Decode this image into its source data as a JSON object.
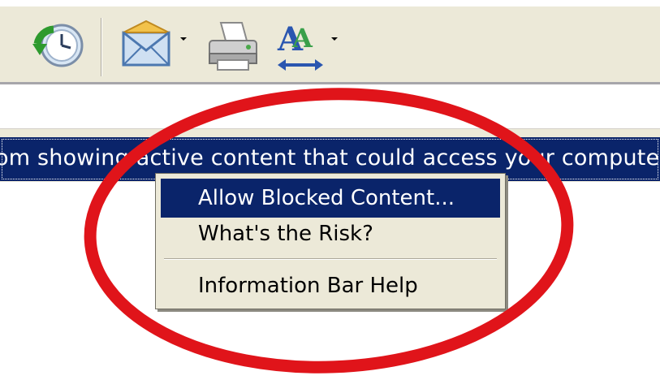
{
  "toolbar": {
    "buttons": [
      {
        "name": "history-button",
        "icon": "history-clock-icon"
      },
      {
        "name": "mail-button",
        "icon": "mail-envelope-icon",
        "has_dropdown": true
      },
      {
        "name": "print-button",
        "icon": "printer-icon"
      },
      {
        "name": "text-size-button",
        "icon": "font-size-icon",
        "has_dropdown": true
      }
    ]
  },
  "infobar": {
    "message": "om showing active content that could access your computer. C"
  },
  "context_menu": {
    "items": [
      {
        "label": "Allow Blocked Content...",
        "selected": true
      },
      {
        "label": "What's the Risk?",
        "selected": false
      },
      {
        "label": "Information Bar Help",
        "selected": false
      }
    ]
  },
  "colors": {
    "selection": "#0a246a",
    "menu_bg": "#ece9d8",
    "highlight_ring": "#e0141a"
  }
}
